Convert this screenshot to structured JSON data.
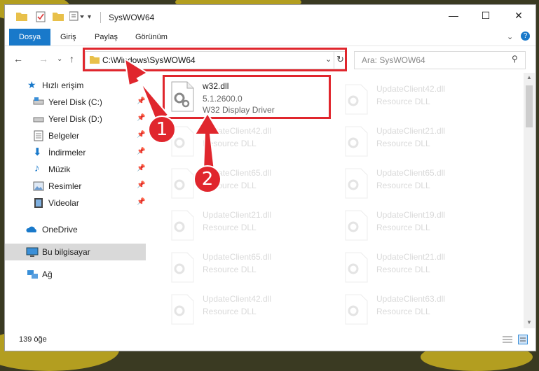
{
  "window": {
    "title": "SysWOW64",
    "buttons": {
      "minimize": "—",
      "maximize": "☐",
      "close": "✕"
    }
  },
  "ribbon": {
    "tabs": [
      "Dosya",
      "Giriş",
      "Paylaş",
      "Görünüm"
    ],
    "expand_icon": "chevron-down-icon",
    "help_icon": "help-icon"
  },
  "address": {
    "path": "C:\\Windows\\SysWOW64",
    "search_placeholder": "Ara: SysWOW64"
  },
  "sidebar": {
    "items": [
      {
        "label": "Hızlı erişim",
        "icon": "star-icon"
      },
      {
        "label": "Yerel Disk (C:)",
        "icon": "drive-icon"
      },
      {
        "label": "Yerel Disk (D:)",
        "icon": "drive-icon"
      },
      {
        "label": "Belgeler",
        "icon": "documents-icon"
      },
      {
        "label": "İndirmeler",
        "icon": "downloads-icon"
      },
      {
        "label": "Müzik",
        "icon": "music-icon"
      },
      {
        "label": "Resimler",
        "icon": "pictures-icon"
      },
      {
        "label": "Videolar",
        "icon": "videos-icon"
      },
      {
        "label": "OneDrive",
        "icon": "cloud-icon"
      },
      {
        "label": "Bu bilgisayar",
        "icon": "computer-icon"
      },
      {
        "label": "Ağ",
        "icon": "network-icon"
      }
    ]
  },
  "files": {
    "primary": {
      "name": "w32.dll",
      "version": "5.1.2600.0",
      "description": "W32 Display Driver"
    },
    "faded": [
      {
        "name": "UpdateClient42.dll",
        "description": "Resource DLL"
      },
      {
        "name": "UpdateClient42.dll",
        "description": "Resource DLL"
      },
      {
        "name": "UpdateClient21.dll",
        "description": "Resource DLL"
      },
      {
        "name": "UpdateClient65.dll",
        "description": "Resource DLL"
      },
      {
        "name": "UpdateClient65.dll",
        "description": "Resource DLL"
      },
      {
        "name": "UpdateClient21.dll",
        "description": "Resource DLL"
      },
      {
        "name": "UpdateClient19.dll",
        "description": "Resource DLL"
      },
      {
        "name": "UpdateClient65.dll",
        "description": "Resource DLL"
      },
      {
        "name": "UpdateClient21.dll",
        "description": "Resource DLL"
      },
      {
        "name": "UpdateClient42.dll",
        "description": "Resource DLL"
      },
      {
        "name": "UpdateClient63.dll",
        "description": "Resource DLL"
      }
    ]
  },
  "status": {
    "item_count": "139 öğe"
  },
  "annotations": {
    "step1": "1",
    "step2": "2",
    "color": "#e0262d"
  }
}
